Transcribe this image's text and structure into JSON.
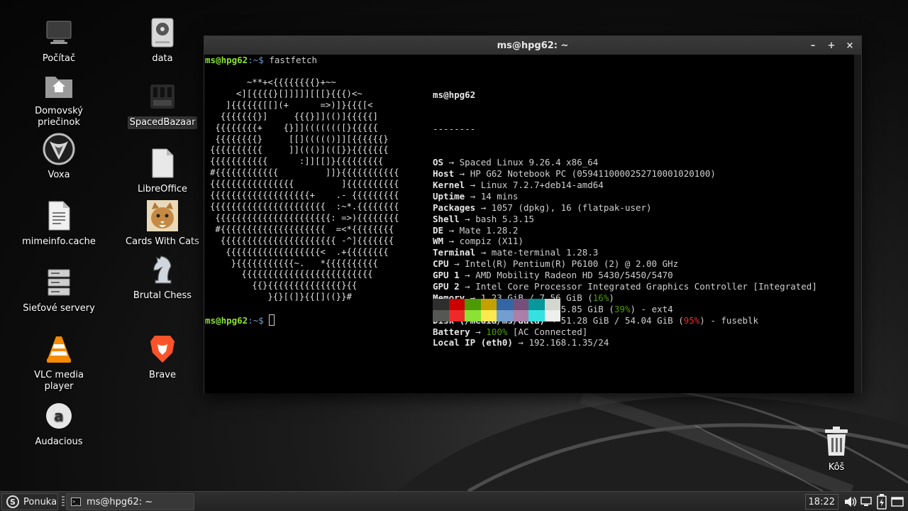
{
  "desktop": {
    "icons": [
      {
        "label": "Počítač",
        "icon": "computer-icon"
      },
      {
        "label": "data",
        "icon": "drive-icon"
      },
      {
        "label": "Domovský priečinok",
        "icon": "home-folder-icon"
      },
      {
        "label": "SpacedBazaar",
        "icon": "store-icon"
      },
      {
        "label": "Voxa",
        "icon": "voxa-icon"
      },
      {
        "label": "LibreOffice",
        "icon": "document-icon"
      },
      {
        "label": "mimeinfo.cache",
        "icon": "text-file-icon"
      },
      {
        "label": "Cards With Cats",
        "icon": "cat-icon"
      },
      {
        "label": "Sieťové servery",
        "icon": "server-icon"
      },
      {
        "label": "Brutal Chess",
        "icon": "chess-knight-icon"
      },
      {
        "label": "VLC media player",
        "icon": "vlc-cone-icon"
      },
      {
        "label": "Brave",
        "icon": "brave-lion-icon"
      },
      {
        "label": "Audacious",
        "icon": "audacious-icon"
      },
      {
        "label": "Kôš",
        "icon": "trash-icon"
      }
    ]
  },
  "terminal": {
    "title": "ms@hpg62: ~",
    "buttons": {
      "minimize": "–",
      "maximize": "+",
      "close": "×"
    },
    "prompt_user": "ms@hpg62",
    "prompt_path": ":~$ ",
    "command": "fastfetch",
    "ascii_art": "       ~**+<{{{{{{{{}+~~\n     <][{{{{}[]]]]][[[}{{{)<~\n   ]{{{{{{[[](+      =>)]}{{{[<\n  {{{{{{{}]     {{{}]](()]{{{{{]\n {{{{{{{{+    {}]]((((((([}{{{{{\n {{{{{{{{}     [[]((((()]][{{{{{{}\n{{{{{{{{{{     ]]((()](([}}{{{{{{{\n{{{{{{{{{{{      :]][[]}{{{{{{{{{\n#{{{{{{{{{{{{         ]]}{{{{{{{{{{{\n{{{{{{{{{{{{{{{{         ]{{{{{{{{{{\n{{{{{{{{{{{{{{{{{{{+    .- {{{{{{{{{\n{{{{{{{{{{{{{{{{{{{{{{  :~*.{{{{{{{{\n {{{{{{{{{{{{{{{{{{{{{{: =>){{{{{{{{\n #{{{{{{{{{{{{{{{{{{{{  =<*{{{{{{{{\n  {{{{{{{{{{{{{{{{{{{{{{ -^]{{{{{{{\n   {{{{{{{{{{{{{{{{{{<  .+{{{{{{{{\n    }{{{{{{{{{{{~.   *{{{{{{{{{{\n      {{{{{{{{{{{{{{{{{{{{{{{{{\n        {{}{{{{{{{{{{{{{{}{{\n           }{}[(]}{{[]((}}#",
    "user_host": "ms@hpg62",
    "separator": "--------",
    "info": [
      {
        "key": "OS",
        "value": "Spaced Linux 9.26.4 x86_64"
      },
      {
        "key": "Host",
        "value": "HP G62 Notebook PC (0594110000252710001020100)"
      },
      {
        "key": "Kernel",
        "value": "Linux 7.2.7+deb14-amd64"
      },
      {
        "key": "Uptime",
        "value": "14 mins"
      },
      {
        "key": "Packages",
        "value": "1057 (dpkg), 16 (flatpak-user)"
      },
      {
        "key": "Shell",
        "value": "bash 5.3.15"
      },
      {
        "key": "DE",
        "value": "Mate 1.28.2"
      },
      {
        "key": "WM",
        "value": "compiz (X11)"
      },
      {
        "key": "Terminal",
        "value": "mate-terminal 1.28.3"
      },
      {
        "key": "CPU",
        "value": "Intel(R) Pentium(R) P6100 (2) @ 2.00 GHz"
      },
      {
        "key": "GPU 1",
        "value": "AMD Mobility Radeon HD 5430/5450/5470"
      },
      {
        "key": "GPU 2",
        "value": "Intel Core Processor Integrated Graphics Controller [Integrated]"
      },
      {
        "key": "Memory",
        "value": "1.23 GiB / 7.56 GiB (",
        "pct": "16%",
        "pct_color": "green",
        "tail": ")"
      },
      {
        "key": "Disk (/)",
        "value": "13.85 GiB / 35.85 GiB (",
        "pct": "39%",
        "pct_color": "green",
        "tail": ") - ext4"
      },
      {
        "key": "Disk (/media/ms/data)",
        "value": "51.28 GiB / 54.04 GiB (",
        "pct": "95%",
        "pct_color": "red",
        "tail": ") - fuseblk"
      },
      {
        "key": "Battery",
        "value": "",
        "pct": "100%",
        "pct_color": "green",
        "tail": " [AC Connected]"
      },
      {
        "key": "Local IP (eth0)",
        "value": "192.168.1.35/24"
      }
    ],
    "arrow": "→",
    "palette_top": [
      "#2e2e2e",
      "#cc0000",
      "#4e9a06",
      "#c4a000",
      "#3465a4",
      "#75507b",
      "#06989a",
      "#d3d7cf"
    ],
    "palette_bottom": [
      "#555753",
      "#ef2929",
      "#8ae234",
      "#fce94f",
      "#729fcf",
      "#ad7fa8",
      "#34e2e2",
      "#eeeeec"
    ]
  },
  "taskbar": {
    "menu_label": "Ponuka",
    "menu_logo": "S",
    "window_item": "ms@hpg62: ~",
    "clock": "18:22"
  }
}
